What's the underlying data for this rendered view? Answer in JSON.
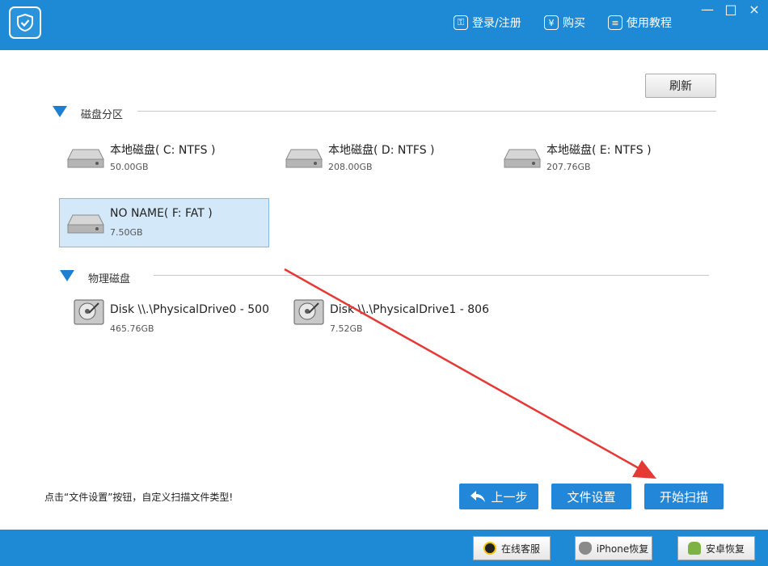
{
  "header": {
    "login_label": "登录/注册",
    "buy_label": "购买",
    "buy_icon_glyph": "¥",
    "tutorial_label": "使用教程"
  },
  "window_controls": {
    "minimize": "—",
    "maximize": "□",
    "close": "×"
  },
  "refresh_label": "刷新",
  "partitions": {
    "title": "磁盘分区",
    "items": [
      {
        "name": "本地磁盘( C: NTFS )",
        "size": "50.00GB"
      },
      {
        "name": "本地磁盘( D: NTFS )",
        "size": "208.00GB"
      },
      {
        "name": "本地磁盘( E: NTFS )",
        "size": "207.76GB"
      },
      {
        "name": "NO NAME( F: FAT )",
        "size": "7.50GB",
        "selected": true
      }
    ]
  },
  "physical": {
    "title": "物理磁盘",
    "items": [
      {
        "name": "Disk \\\\.\\PhysicalDrive0 - 500",
        "size": "465.76GB"
      },
      {
        "name": "Disk \\\\.\\PhysicalDrive1 - 806",
        "size": "7.52GB"
      }
    ]
  },
  "hint": "点击“文件设置”按钮，自定义扫描文件类型!",
  "actions": {
    "prev_label": "上一步",
    "settings_label": "文件设置",
    "scan_label": "开始扫描"
  },
  "statusbar": {
    "service_label": "在线客服",
    "iphone_label": "iPhone恢复",
    "android_label": "安卓恢复"
  },
  "colors": {
    "accent": "#1e8ad6",
    "button": "#2287d8",
    "selected_bg": "#d3e9fa",
    "annotation": "#e53935"
  }
}
